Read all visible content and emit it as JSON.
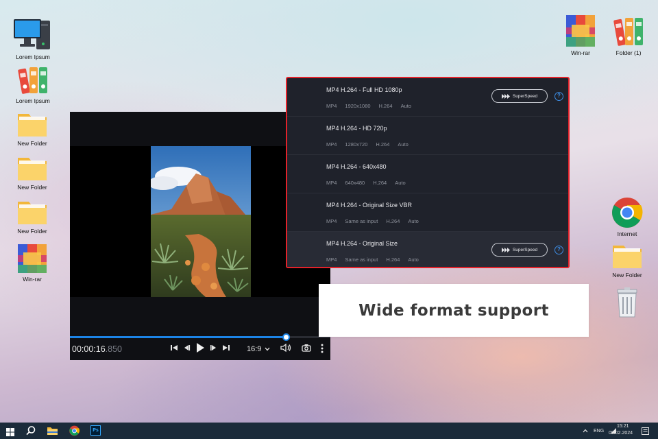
{
  "desktop": {
    "left_icons": [
      {
        "label": "Lorem Ipsum",
        "icon": "computer-icon"
      },
      {
        "label": "Lorem Ipsum",
        "icon": "binders-icon"
      },
      {
        "label": "New Folder",
        "icon": "folder-icon"
      },
      {
        "label": "New Folder",
        "icon": "folder-icon"
      },
      {
        "label": "New Folder",
        "icon": "folder-icon"
      },
      {
        "label": "Win-rar",
        "icon": "winrar-icon"
      }
    ],
    "top_right_icons": [
      {
        "label": "Win-rar",
        "icon": "winrar-icon"
      },
      {
        "label": "Folder (1)",
        "icon": "binders-icon"
      }
    ],
    "right_icons": [
      {
        "label": "Internet",
        "icon": "chrome-icon"
      },
      {
        "label": "New Folder",
        "icon": "folder-icon"
      },
      {
        "label": "",
        "icon": "recycle-bin-icon"
      }
    ]
  },
  "player": {
    "time_main": "00:00:16",
    "time_frac": ".850",
    "progress": 0.83,
    "aspect_ratio": "16:9",
    "accent": "#1c84e6"
  },
  "formats": [
    {
      "name": "MP4 H.264 - Full HD 1080p",
      "specs": [
        "MP4",
        "1920x1080",
        "H.264",
        "Auto"
      ],
      "superspeed": true
    },
    {
      "name": "MP4 H.264 - HD 720p",
      "specs": [
        "MP4",
        "1280x720",
        "H.264",
        "Auto"
      ],
      "superspeed": false
    },
    {
      "name": "MP4 H.264 - 640x480",
      "specs": [
        "MP4",
        "640x480",
        "H.264",
        "Auto"
      ],
      "superspeed": false
    },
    {
      "name": "MP4 H.264 - Original Size VBR",
      "specs": [
        "MP4",
        "Same as input",
        "H.264",
        "Auto"
      ],
      "superspeed": false
    },
    {
      "name": "MP4 H.264 - Original Size",
      "specs": [
        "MP4",
        "Same as input",
        "H.264",
        "Auto"
      ],
      "superspeed": true
    }
  ],
  "superspeed_label": "SuperSpeed",
  "help_glyph": "?",
  "callout": {
    "text": "Wide format support"
  },
  "taskbar": {
    "language": "ENG",
    "time": "15:21",
    "date": "08.02.2024",
    "ps_label": "Ps"
  }
}
